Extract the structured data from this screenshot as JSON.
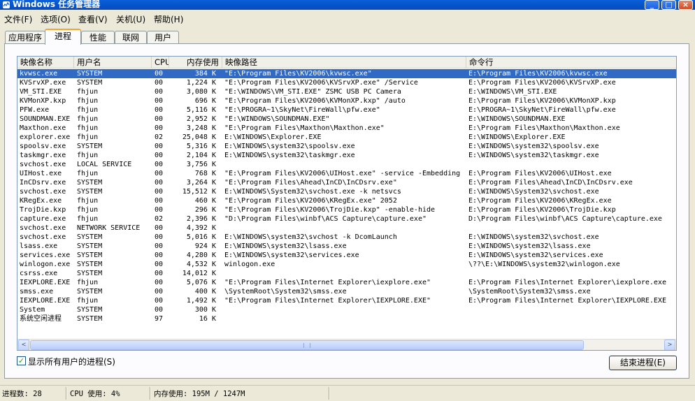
{
  "window": {
    "title": "Windows 任务管理器",
    "min_label": "_",
    "max_label": "□",
    "close_label": "×"
  },
  "menu": [
    {
      "label": "文件(F)"
    },
    {
      "label": "选项(O)"
    },
    {
      "label": "查看(V)"
    },
    {
      "label": "关机(U)"
    },
    {
      "label": "帮助(H)"
    }
  ],
  "tabs": [
    {
      "label": "应用程序",
      "active": false
    },
    {
      "label": "进程",
      "active": true
    },
    {
      "label": "性能",
      "active": false
    },
    {
      "label": "联网",
      "active": false
    },
    {
      "label": "用户",
      "active": false
    }
  ],
  "columns": [
    "映像名称",
    "用户名",
    "CPU",
    "内存使用",
    "映像路径",
    "命令行"
  ],
  "processes": [
    {
      "name": "kvwsc.exe",
      "user": "SYSTEM",
      "cpu": "00",
      "mem": "384 K",
      "path": "\"E:\\Program Files\\KV2006\\kvwsc.exe\"",
      "cmd": "E:\\Program Files\\KV2006\\kvwsc.exe",
      "selected": true
    },
    {
      "name": "KVSrvXP.exe",
      "user": "SYSTEM",
      "cpu": "00",
      "mem": "1,224 K",
      "path": "\"E:\\Program Files\\KV2006\\KVSrvXP.exe\" /Service",
      "cmd": "E:\\Program Files\\KV2006\\KVSrvXP.exe"
    },
    {
      "name": "VM_STI.EXE",
      "user": "fhjun",
      "cpu": "00",
      "mem": "3,080 K",
      "path": "\"E:\\WINDOWS\\VM_STI.EXE\" ZSMC USB PC Camera",
      "cmd": "E:\\WINDOWS\\VM_STI.EXE"
    },
    {
      "name": "KVMonXP.kxp",
      "user": "fhjun",
      "cpu": "00",
      "mem": "696 K",
      "path": "\"E:\\Program Files\\KV2006\\KVMonXP.kxp\" /auto",
      "cmd": "E:\\Program Files\\KV2006\\KVMonXP.kxp"
    },
    {
      "name": "PFW.exe",
      "user": "fhjun",
      "cpu": "00",
      "mem": "5,116 K",
      "path": "\"E:\\PROGRA~1\\SkyNet\\FireWall\\pfw.exe\"",
      "cmd": "E:\\PROGRA~1\\SkyNet\\FireWall\\pfw.exe"
    },
    {
      "name": "SOUNDMAN.EXE",
      "user": "fhjun",
      "cpu": "00",
      "mem": "2,952 K",
      "path": "\"E:\\WINDOWS\\SOUNDMAN.EXE\"",
      "cmd": "E:\\WINDOWS\\SOUNDMAN.EXE"
    },
    {
      "name": "Maxthon.exe",
      "user": "fhjun",
      "cpu": "00",
      "mem": "3,248 K",
      "path": "\"E:\\Program Files\\Maxthon\\Maxthon.exe\"",
      "cmd": "E:\\Program Files\\Maxthon\\Maxthon.exe"
    },
    {
      "name": "explorer.exe",
      "user": "fhjun",
      "cpu": "02",
      "mem": "25,048 K",
      "path": "E:\\WINDOWS\\Explorer.EXE",
      "cmd": "E:\\WINDOWS\\Explorer.EXE"
    },
    {
      "name": "spoolsv.exe",
      "user": "SYSTEM",
      "cpu": "00",
      "mem": "5,316 K",
      "path": "E:\\WINDOWS\\system32\\spoolsv.exe",
      "cmd": "E:\\WINDOWS\\system32\\spoolsv.exe"
    },
    {
      "name": "taskmgr.exe",
      "user": "fhjun",
      "cpu": "00",
      "mem": "2,104 K",
      "path": "E:\\WINDOWS\\system32\\taskmgr.exe",
      "cmd": "E:\\WINDOWS\\system32\\taskmgr.exe"
    },
    {
      "name": "svchost.exe",
      "user": "LOCAL SERVICE",
      "cpu": "00",
      "mem": "3,756 K",
      "path": "",
      "cmd": ""
    },
    {
      "name": "UIHost.exe",
      "user": "fhjun",
      "cpu": "00",
      "mem": "768 K",
      "path": "\"E:\\Program Files\\KV2006\\UIHost.exe\" -service -Embedding",
      "cmd": "E:\\Program Files\\KV2006\\UIHost.exe"
    },
    {
      "name": "InCDsrv.exe",
      "user": "SYSTEM",
      "cpu": "00",
      "mem": "3,264 K",
      "path": "\"E:\\Program Files\\Ahead\\InCD\\InCDsrv.exe\"",
      "cmd": "E:\\Program Files\\Ahead\\InCD\\InCDsrv.exe"
    },
    {
      "name": "svchost.exe",
      "user": "SYSTEM",
      "cpu": "00",
      "mem": "15,512 K",
      "path": "E:\\WINDOWS\\System32\\svchost.exe -k netsvcs",
      "cmd": "E:\\WINDOWS\\System32\\svchost.exe"
    },
    {
      "name": "KRegEx.exe",
      "user": "fhjun",
      "cpu": "00",
      "mem": "460 K",
      "path": "\"E:\\Program Files\\KV2006\\KRegEx.exe\" 2052",
      "cmd": "E:\\Program Files\\KV2006\\KRegEx.exe"
    },
    {
      "name": "TrojDie.kxp",
      "user": "fhjun",
      "cpu": "00",
      "mem": "296 K",
      "path": "\"E:\\Program Files\\KV2006\\TrojDie.kxp\" -enable-hide",
      "cmd": "E:\\Program Files\\KV2006\\TrojDie.kxp"
    },
    {
      "name": "capture.exe",
      "user": "fhjun",
      "cpu": "02",
      "mem": "2,396 K",
      "path": "\"D:\\Program Files\\winbf\\ACS Capture\\capture.exe\"",
      "cmd": "D:\\Program Files\\winbf\\ACS Capture\\capture.exe"
    },
    {
      "name": "svchost.exe",
      "user": "NETWORK SERVICE",
      "cpu": "00",
      "mem": "4,392 K",
      "path": "",
      "cmd": ""
    },
    {
      "name": "svchost.exe",
      "user": "SYSTEM",
      "cpu": "00",
      "mem": "5,016 K",
      "path": "E:\\WINDOWS\\system32\\svchost -k DcomLaunch",
      "cmd": "E:\\WINDOWS\\system32\\svchost.exe"
    },
    {
      "name": "lsass.exe",
      "user": "SYSTEM",
      "cpu": "00",
      "mem": "924 K",
      "path": "E:\\WINDOWS\\system32\\lsass.exe",
      "cmd": "E:\\WINDOWS\\system32\\lsass.exe"
    },
    {
      "name": "services.exe",
      "user": "SYSTEM",
      "cpu": "00",
      "mem": "4,280 K",
      "path": "E:\\WINDOWS\\system32\\services.exe",
      "cmd": "E:\\WINDOWS\\system32\\services.exe"
    },
    {
      "name": "winlogon.exe",
      "user": "SYSTEM",
      "cpu": "00",
      "mem": "4,532 K",
      "path": "winlogon.exe",
      "cmd": "\\??\\E:\\WINDOWS\\system32\\winlogon.exe"
    },
    {
      "name": "csrss.exe",
      "user": "SYSTEM",
      "cpu": "00",
      "mem": "14,012 K",
      "path": "",
      "cmd": ""
    },
    {
      "name": "IEXPLORE.EXE",
      "user": "fhjun",
      "cpu": "00",
      "mem": "5,076 K",
      "path": "\"E:\\Program Files\\Internet Explorer\\iexplore.exe\"",
      "cmd": "E:\\Program Files\\Internet Explorer\\iexplore.exe"
    },
    {
      "name": "smss.exe",
      "user": "SYSTEM",
      "cpu": "00",
      "mem": "400 K",
      "path": "\\SystemRoot\\System32\\smss.exe",
      "cmd": "\\SystemRoot\\System32\\smss.exe"
    },
    {
      "name": "IEXPLORE.EXE",
      "user": "fhjun",
      "cpu": "00",
      "mem": "1,492 K",
      "path": "\"E:\\Program Files\\Internet Explorer\\IEXPLORE.EXE\"",
      "cmd": "E:\\Program Files\\Internet Explorer\\IEXPLORE.EXE"
    },
    {
      "name": "System",
      "user": "SYSTEM",
      "cpu": "00",
      "mem": "300 K",
      "path": "",
      "cmd": ""
    },
    {
      "name": "系统空闲进程",
      "user": "SYSTEM",
      "cpu": "97",
      "mem": "16 K",
      "path": "",
      "cmd": ""
    }
  ],
  "scrollbar": {
    "left_arrow": "<",
    "right_arrow": ">"
  },
  "show_all_users": {
    "label": "显示所有用户的进程(S)",
    "checked": true,
    "check_glyph": "✓"
  },
  "end_process": {
    "label": "结束进程(E)"
  },
  "status": {
    "processes": "进程数: 28",
    "cpu": "CPU 使用: 4%",
    "memory": "内存使用: 195M / 1247M"
  }
}
